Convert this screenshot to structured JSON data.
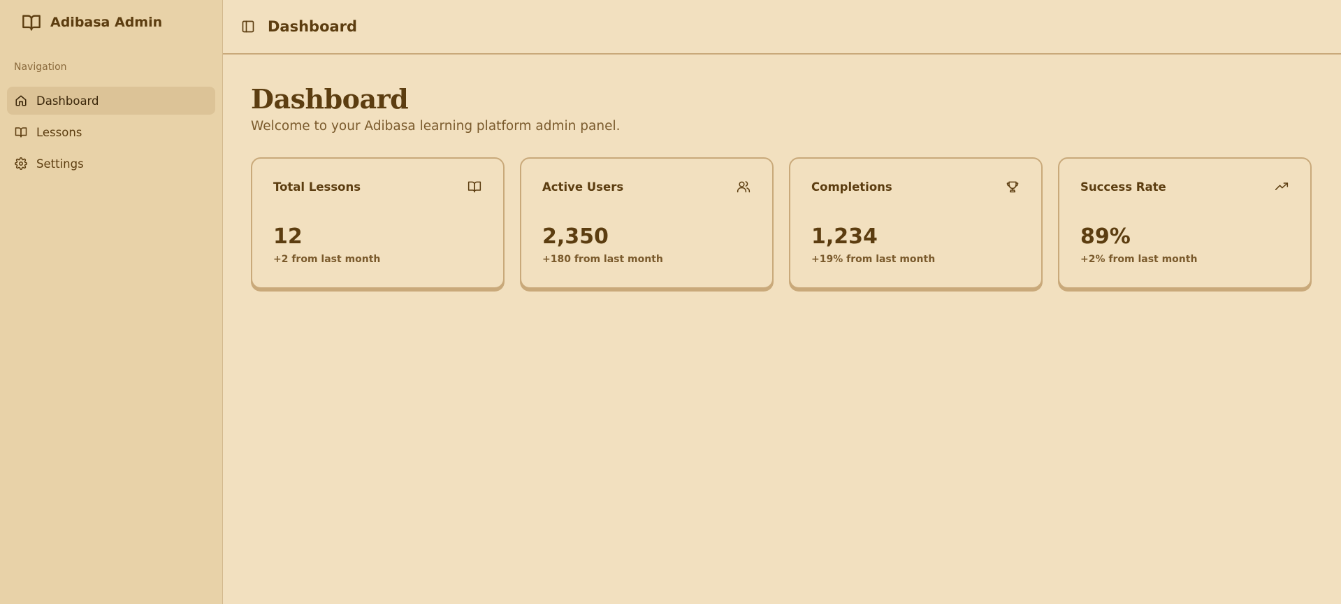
{
  "brand": {
    "title": "Adibasa Admin",
    "icon": "book-open-icon"
  },
  "sidebar": {
    "group_label": "Navigation",
    "items": [
      {
        "label": "Dashboard",
        "icon": "home-icon",
        "active": true
      },
      {
        "label": "Lessons",
        "icon": "book-open-icon",
        "active": false
      },
      {
        "label": "Settings",
        "icon": "gear-icon",
        "active": false
      }
    ]
  },
  "topbar": {
    "title": "Dashboard",
    "toggle_icon": "sidebar-toggle-icon"
  },
  "page": {
    "title": "Dashboard",
    "subtitle": "Welcome to your Adibasa learning platform admin panel."
  },
  "stats": [
    {
      "title": "Total Lessons",
      "value": "12",
      "change": "+2 from last month",
      "icon": "book-open-icon"
    },
    {
      "title": "Active Users",
      "value": "2,350",
      "change": "+180 from last month",
      "icon": "users-icon"
    },
    {
      "title": "Completions",
      "value": "1,234",
      "change": "+19% from last month",
      "icon": "trophy-icon"
    },
    {
      "title": "Success Rate",
      "value": "89%",
      "change": "+2% from last month",
      "icon": "trending-up-icon"
    }
  ],
  "colors": {
    "background": "#f2e0bf",
    "sidebar": "#e8d2a8",
    "accent_text": "#5c3d10",
    "muted_text": "#7a5a2c",
    "border": "#c9a97a",
    "active_item": "#dcc397"
  }
}
